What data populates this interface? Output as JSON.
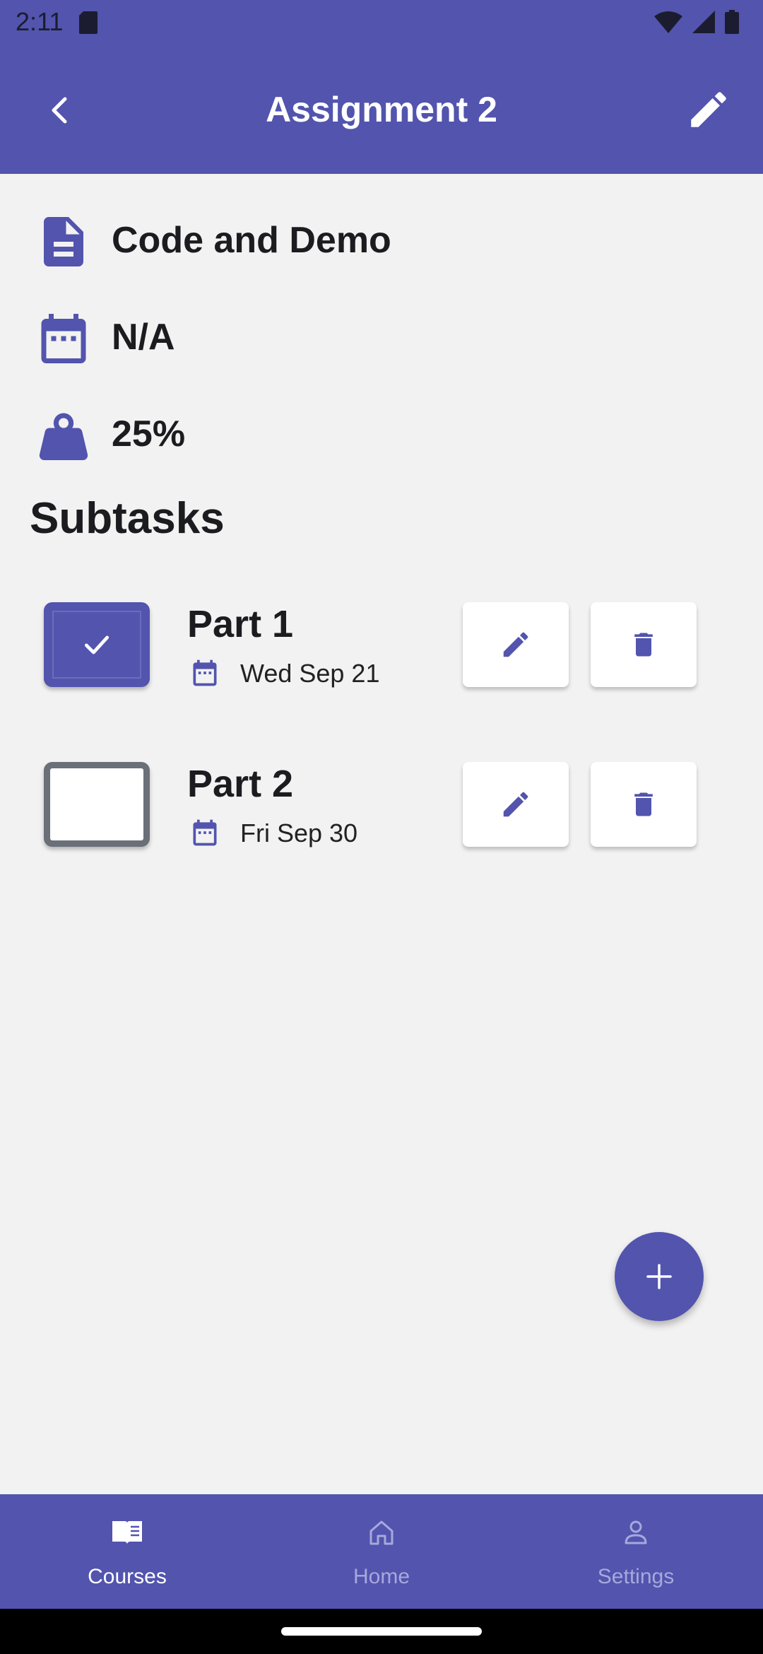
{
  "status_bar": {
    "time": "2:11"
  },
  "header": {
    "title": "Assignment 2"
  },
  "details": {
    "name": "Code and Demo",
    "due": "N/A",
    "weight": "25%"
  },
  "subtasks": {
    "heading": "Subtasks",
    "items": [
      {
        "title": "Part 1",
        "date": "Wed Sep 21",
        "checked": true
      },
      {
        "title": "Part 2",
        "date": "Fri Sep 30",
        "checked": false
      }
    ]
  },
  "bottom_nav": {
    "items": [
      {
        "label": "Courses",
        "icon": "book-icon",
        "active": true
      },
      {
        "label": "Home",
        "icon": "home-icon",
        "active": false
      },
      {
        "label": "Settings",
        "icon": "person-icon",
        "active": false
      }
    ]
  },
  "colors": {
    "primary": "#5254ae",
    "background": "#f2f2f2",
    "inactive_nav": "#a7a8dc"
  }
}
